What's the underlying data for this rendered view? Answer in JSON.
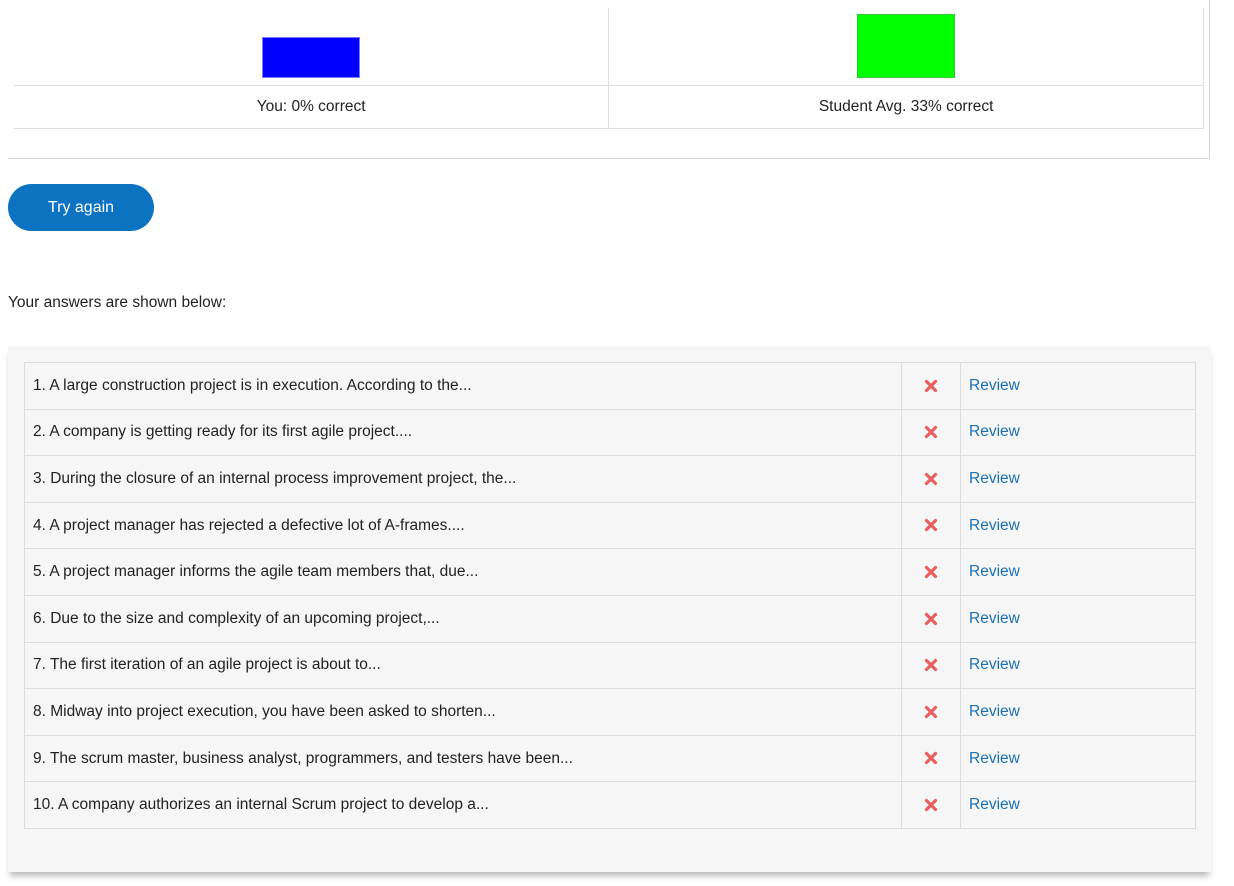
{
  "results": {
    "you": {
      "label": "You: 0% correct",
      "percent": 0,
      "color": "#0000ff"
    },
    "average": {
      "label": "Student Avg. 33% correct",
      "percent": 33,
      "color": "#00ff00"
    }
  },
  "actions": {
    "try_again_label": "Try again"
  },
  "answers_intro": "Your answers are shown below:",
  "answers": [
    {
      "question": "1. A large construction project is in execution. According to the...",
      "status": "incorrect",
      "status_icon": "red-x-icon",
      "link": "Review"
    },
    {
      "question": "2. A company is getting ready for its first agile project....",
      "status": "incorrect",
      "status_icon": "red-x-icon",
      "link": "Review"
    },
    {
      "question": "3. During the closure of an internal process improvement project, the...",
      "status": "incorrect",
      "status_icon": "red-x-icon",
      "link": "Review"
    },
    {
      "question": "4. A project manager has rejected a defective lot of A-frames....",
      "status": "incorrect",
      "status_icon": "red-x-icon",
      "link": "Review"
    },
    {
      "question": "5. A project manager informs the agile team members that, due...",
      "status": "incorrect",
      "status_icon": "red-x-icon",
      "link": "Review"
    },
    {
      "question": "6. Due to the size and complexity of an upcoming project,...",
      "status": "incorrect",
      "status_icon": "red-x-icon",
      "link": "Review"
    },
    {
      "question": "7. The first iteration of an agile project is about to...",
      "status": "incorrect",
      "status_icon": "red-x-icon",
      "link": "Review"
    },
    {
      "question": "8. Midway into project execution, you have been asked to shorten...",
      "status": "incorrect",
      "status_icon": "red-x-icon",
      "link": "Review"
    },
    {
      "question": "9. The scrum master, business analyst, programmers, and testers have been...",
      "status": "incorrect",
      "status_icon": "red-x-icon",
      "link": "Review"
    },
    {
      "question": "10. A company authorizes an internal Scrum project to develop a...",
      "status": "incorrect",
      "status_icon": "red-x-icon",
      "link": "Review"
    }
  ]
}
